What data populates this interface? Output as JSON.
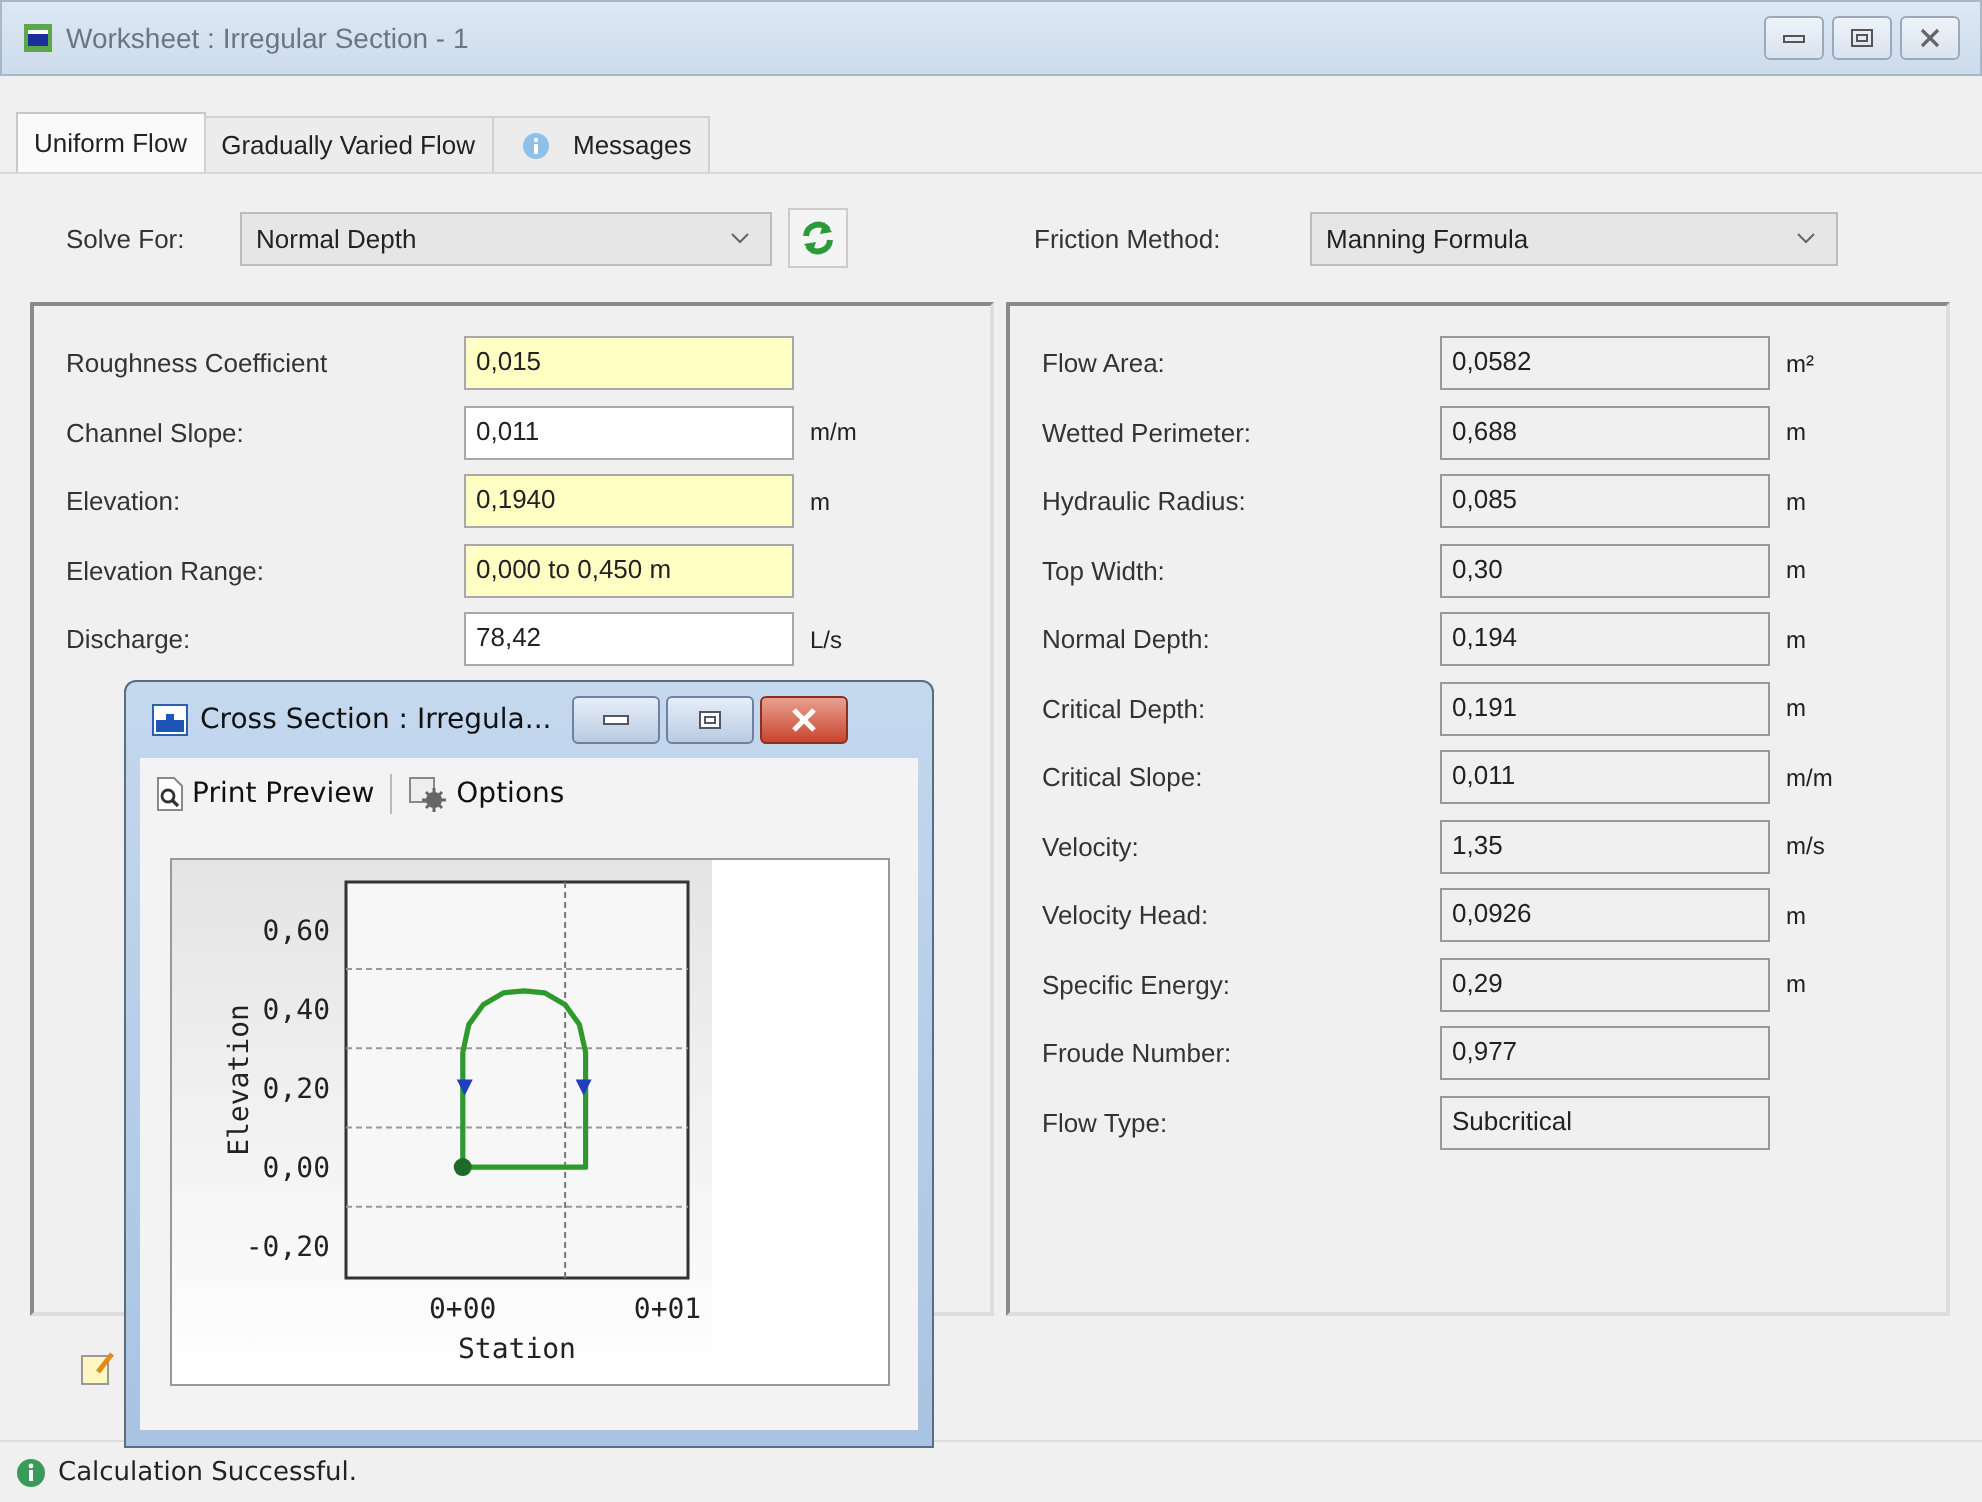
{
  "window": {
    "title": "Worksheet : Irregular Section - 1"
  },
  "tabs": [
    {
      "label": "Uniform Flow",
      "selected": true,
      "kind": "plain"
    },
    {
      "label": "Gradually Varied Flow",
      "selected": false,
      "kind": "plain"
    },
    {
      "label": "Messages",
      "selected": false,
      "kind": "info"
    }
  ],
  "solve_for": {
    "label": "Solve For:",
    "value": "Normal Depth"
  },
  "friction_method": {
    "label": "Friction Method:",
    "value": "Manning Formula"
  },
  "inputs": [
    {
      "label": "Roughness Coefficient",
      "value": "0,015",
      "highlighted": true
    },
    {
      "label": "Channel Slope:",
      "value": "0,011",
      "unit": "m/m",
      "highlighted": false
    },
    {
      "label": "Elevation:",
      "value": "0,1940",
      "unit": "m",
      "highlighted": true
    },
    {
      "label": "Elevation Range:",
      "value": "0,000 to 0,450 m",
      "highlighted": true
    },
    {
      "label": "Discharge:",
      "value": "78,42",
      "unit": "L/s",
      "highlighted": false
    }
  ],
  "results": [
    {
      "label": "Flow Area:",
      "value": "0,0582",
      "unit": "m²"
    },
    {
      "label": "Wetted Perimeter:",
      "value": "0,688",
      "unit": "m"
    },
    {
      "label": "Hydraulic Radius:",
      "value": "0,085",
      "unit": "m"
    },
    {
      "label": "Top Width:",
      "value": "0,30",
      "unit": "m"
    },
    {
      "label": "Normal Depth:",
      "value": "0,194",
      "unit": "m"
    },
    {
      "label": "Critical Depth:",
      "value": "0,191",
      "unit": "m"
    },
    {
      "label": "Critical Slope:",
      "value": "0,011",
      "unit": "m/m"
    },
    {
      "label": "Velocity:",
      "value": "1,35",
      "unit": "m/s"
    },
    {
      "label": "Velocity Head:",
      "value": "0,0926",
      "unit": "m"
    },
    {
      "label": "Specific Energy:",
      "value": "0,29",
      "unit": "m"
    },
    {
      "label": "Froude Number:",
      "value": "0,977"
    },
    {
      "label": "Flow Type:",
      "value": "Subcritical"
    }
  ],
  "cross_section_window": {
    "title": "Cross Section : Irregula...",
    "toolbar": [
      {
        "label": "Print Preview",
        "kind": "preview"
      },
      {
        "label": "Options",
        "kind": "options"
      }
    ],
    "plot": {
      "xlabel": "Station",
      "ylabel": "Elevation",
      "x_tick_labels": [
        "0+00",
        "0+01"
      ],
      "y_tick_labels": [
        "0,60",
        "0,40",
        "0,20",
        "0,00",
        "-0,20"
      ]
    }
  },
  "status_bar": {
    "text": "Calculation Successful."
  }
}
